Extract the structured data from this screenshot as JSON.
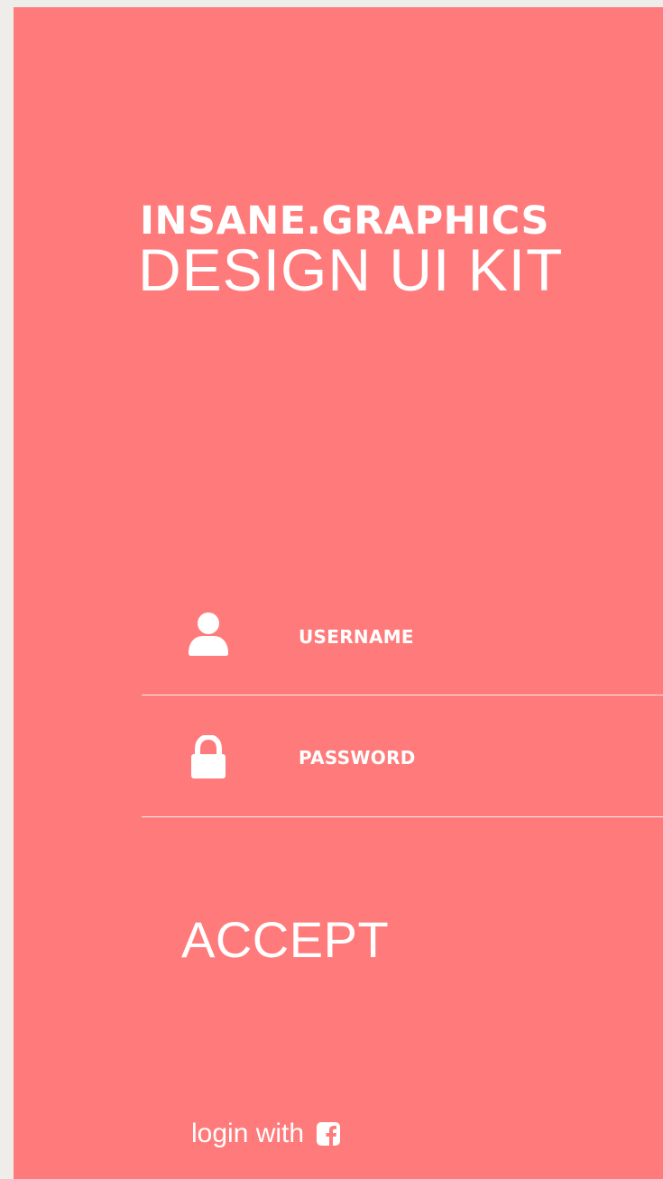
{
  "brand": {
    "title": "INSANE.GRAPHICS",
    "subtitle": "DESIGN UI KIT"
  },
  "form": {
    "username_label": "USERNAME",
    "password_label": "PASSWORD",
    "username_icon": "user-icon",
    "password_icon": "lock-icon"
  },
  "actions": {
    "accept_label": "ACCEPT",
    "login_with_label": "login with",
    "social_icon": "facebook-icon"
  },
  "colors": {
    "background": "#ff7b7b",
    "foreground": "#ffffff",
    "page": "#efedea"
  }
}
